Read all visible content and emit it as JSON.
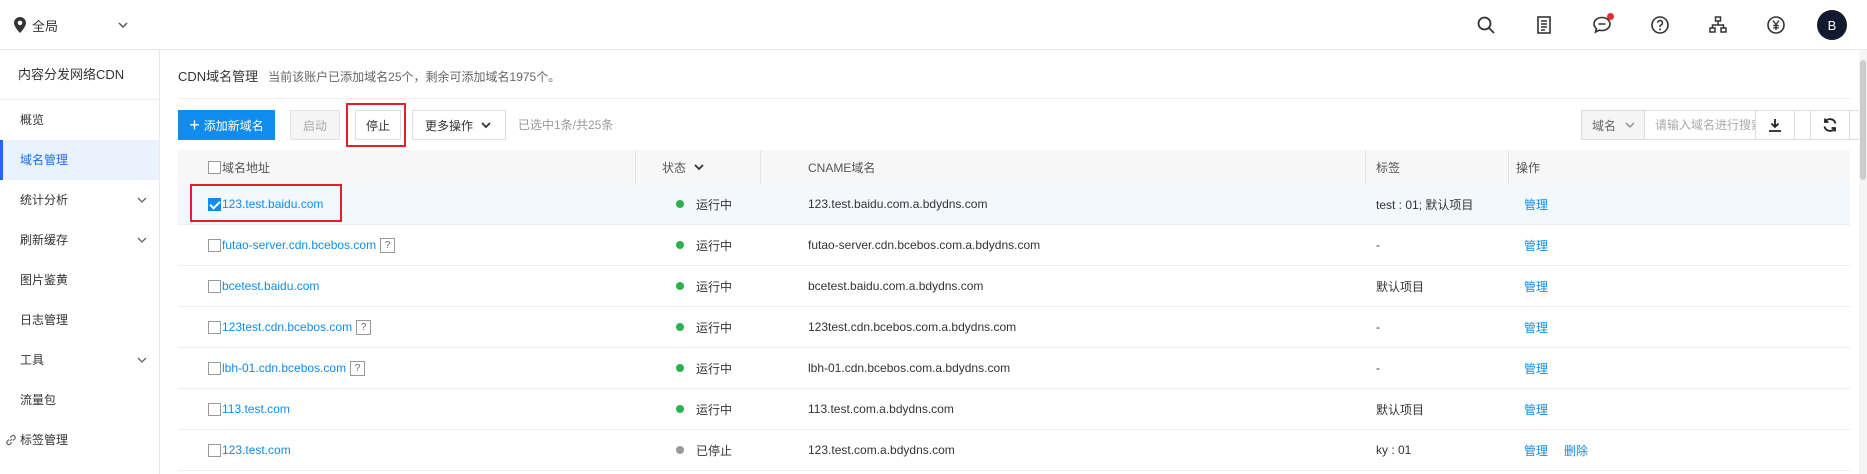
{
  "topbar": {
    "region_label": "全局",
    "avatar_initial": "B",
    "icons": [
      "search-icon",
      "document-icon",
      "message-icon",
      "help-icon",
      "org-icon",
      "yuan-icon"
    ],
    "notify_color": "#e52d2d"
  },
  "sidebar": {
    "title": "内容分发网络CDN",
    "items": [
      {
        "label": "概览",
        "active": false,
        "expandable": false
      },
      {
        "label": "域名管理",
        "active": true,
        "expandable": false
      },
      {
        "label": "统计分析",
        "active": false,
        "expandable": true
      },
      {
        "label": "刷新缓存",
        "active": false,
        "expandable": true
      },
      {
        "label": "图片鉴黄",
        "active": false,
        "expandable": false
      },
      {
        "label": "日志管理",
        "active": false,
        "expandable": false
      },
      {
        "label": "工具",
        "active": false,
        "expandable": true
      },
      {
        "label": "流量包",
        "active": false,
        "expandable": false
      },
      {
        "label": "标签管理",
        "active": false,
        "expandable": false
      }
    ]
  },
  "page": {
    "title": "CDN域名管理",
    "subtitle": "当前该账户已添加域名25个，剩余可添加域名1975个。"
  },
  "toolbar": {
    "add_label": "添加新域名",
    "start_label": "启动",
    "stop_label": "停止",
    "more_label": "更多操作",
    "selection_info": "已选中1条/共25条",
    "search_field": "域名",
    "search_placeholder": "请输入域名进行搜索"
  },
  "table": {
    "headers": {
      "domain": "域名地址",
      "status": "状态",
      "cname": "CNAME域名",
      "tag": "标签",
      "ops": "操作"
    },
    "rows": [
      {
        "domain": "123.test.baidu.com",
        "help": false,
        "status": "运行中",
        "running": true,
        "cname": "123.test.baidu.com.a.bdydns.com",
        "tag": "test : 01; 默认项目",
        "ops": [
          "管理"
        ],
        "checked": true
      },
      {
        "domain": "futao-server.cdn.bcebos.com",
        "help": true,
        "status": "运行中",
        "running": true,
        "cname": "futao-server.cdn.bcebos.com.a.bdydns.com",
        "tag": "-",
        "ops": [
          "管理"
        ],
        "checked": false
      },
      {
        "domain": "bcetest.baidu.com",
        "help": false,
        "status": "运行中",
        "running": true,
        "cname": "bcetest.baidu.com.a.bdydns.com",
        "tag": "默认项目",
        "ops": [
          "管理"
        ],
        "checked": false
      },
      {
        "domain": "123test.cdn.bcebos.com",
        "help": true,
        "status": "运行中",
        "running": true,
        "cname": "123test.cdn.bcebos.com.a.bdydns.com",
        "tag": "-",
        "ops": [
          "管理"
        ],
        "checked": false
      },
      {
        "domain": "lbh-01.cdn.bcebos.com",
        "help": true,
        "status": "运行中",
        "running": true,
        "cname": "lbh-01.cdn.bcebos.com.a.bdydns.com",
        "tag": "-",
        "ops": [
          "管理"
        ],
        "checked": false
      },
      {
        "domain": "113.test.com",
        "help": false,
        "status": "运行中",
        "running": true,
        "cname": "113.test.com.a.bdydns.com",
        "tag": "默认项目",
        "ops": [
          "管理"
        ],
        "checked": false
      },
      {
        "domain": "123.test.com",
        "help": false,
        "status": "已停止",
        "running": false,
        "cname": "123.test.com.a.bdydns.com",
        "tag": "ky : 01",
        "ops": [
          "管理",
          "删除"
        ],
        "checked": false
      }
    ],
    "help_mark": "?",
    "status_colors": {
      "running": "#2bb24c",
      "stopped": "#999999"
    }
  },
  "colors": {
    "primary": "#108cee",
    "highlight": "#e41f2b",
    "active_nav": "#2468f2"
  }
}
